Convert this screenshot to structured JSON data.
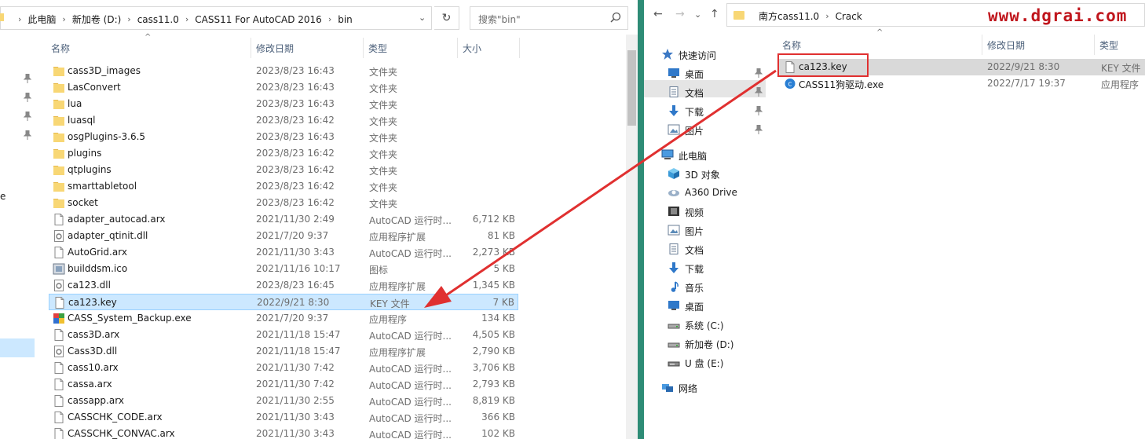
{
  "left_window": {
    "breadcrumb": [
      "此电脑",
      "新加卷 (D:)",
      "cass11.0",
      "CASS11 For AutoCAD 2016",
      "bin"
    ],
    "search_placeholder": "搜索\"bin\"",
    "columns": {
      "name": "名称",
      "date": "修改日期",
      "type": "类型",
      "size": "大小"
    },
    "cut_text": "e",
    "files": [
      {
        "name": "cass3D_images",
        "date": "2023/8/23 16:43",
        "type": "文件夹",
        "size": "",
        "icon": "folder-icon"
      },
      {
        "name": "LasConvert",
        "date": "2023/8/23 16:43",
        "type": "文件夹",
        "size": "",
        "icon": "folder-icon"
      },
      {
        "name": "lua",
        "date": "2023/8/23 16:43",
        "type": "文件夹",
        "size": "",
        "icon": "folder-icon"
      },
      {
        "name": "luasql",
        "date": "2023/8/23 16:42",
        "type": "文件夹",
        "size": "",
        "icon": "folder-icon"
      },
      {
        "name": "osgPlugins-3.6.5",
        "date": "2023/8/23 16:43",
        "type": "文件夹",
        "size": "",
        "icon": "folder-icon"
      },
      {
        "name": "plugins",
        "date": "2023/8/23 16:42",
        "type": "文件夹",
        "size": "",
        "icon": "folder-icon"
      },
      {
        "name": "qtplugins",
        "date": "2023/8/23 16:42",
        "type": "文件夹",
        "size": "",
        "icon": "folder-icon"
      },
      {
        "name": "smarttabletool",
        "date": "2023/8/23 16:42",
        "type": "文件夹",
        "size": "",
        "icon": "folder-icon"
      },
      {
        "name": "socket",
        "date": "2023/8/23 16:42",
        "type": "文件夹",
        "size": "",
        "icon": "folder-icon"
      },
      {
        "name": "adapter_autocad.arx",
        "date": "2021/11/30 2:49",
        "type": "AutoCAD 运行时...",
        "size": "6,712 KB",
        "icon": "document-icon"
      },
      {
        "name": "adapter_qtinit.dll",
        "date": "2021/7/20 9:37",
        "type": "应用程序扩展",
        "size": "81 KB",
        "icon": "dll-icon"
      },
      {
        "name": "AutoGrid.arx",
        "date": "2021/11/30 3:43",
        "type": "AutoCAD 运行时...",
        "size": "2,273 KB",
        "icon": "document-icon"
      },
      {
        "name": "builddsm.ico",
        "date": "2021/11/16 10:17",
        "type": "图标",
        "size": "5 KB",
        "icon": "ico-file-icon"
      },
      {
        "name": "ca123.dll",
        "date": "2023/8/23 16:45",
        "type": "应用程序扩展",
        "size": "1,345 KB",
        "icon": "dll-icon"
      },
      {
        "name": "ca123.key",
        "date": "2022/9/21 8:30",
        "type": "KEY 文件",
        "size": "7 KB",
        "icon": "document-icon",
        "selected": true
      },
      {
        "name": "CASS_System_Backup.exe",
        "date": "2021/7/20 9:37",
        "type": "应用程序",
        "size": "134 KB",
        "icon": "exe-icon"
      },
      {
        "name": "cass3D.arx",
        "date": "2021/11/18 15:47",
        "type": "AutoCAD 运行时...",
        "size": "4,505 KB",
        "icon": "document-icon"
      },
      {
        "name": "Cass3D.dll",
        "date": "2021/11/18 15:47",
        "type": "应用程序扩展",
        "size": "2,790 KB",
        "icon": "dll-icon"
      },
      {
        "name": "cass10.arx",
        "date": "2021/11/30 7:42",
        "type": "AutoCAD 运行时...",
        "size": "3,706 KB",
        "icon": "document-icon"
      },
      {
        "name": "cassa.arx",
        "date": "2021/11/30 7:42",
        "type": "AutoCAD 运行时...",
        "size": "2,793 KB",
        "icon": "document-icon"
      },
      {
        "name": "cassapp.arx",
        "date": "2021/11/30 2:55",
        "type": "AutoCAD 运行时...",
        "size": "8,819 KB",
        "icon": "document-icon"
      },
      {
        "name": "CASSCHK_CODE.arx",
        "date": "2021/11/30 3:43",
        "type": "AutoCAD 运行时...",
        "size": "366 KB",
        "icon": "document-icon"
      },
      {
        "name": "CASSCHK_CONVAC.arx",
        "date": "2021/11/30 3:43",
        "type": "AutoCAD 运行时...",
        "size": "102 KB",
        "icon": "document-icon"
      }
    ]
  },
  "right_window": {
    "breadcrumb": [
      "南方cass11.0",
      "Crack"
    ],
    "watermark": "www.dgrai.com",
    "columns": {
      "name": "名称",
      "date": "修改日期",
      "type": "类型"
    },
    "tree": [
      {
        "label": "快速访问",
        "icon": "star-icon",
        "level": 0,
        "pinned": false
      },
      {
        "label": "桌面",
        "icon": "desktop-icon",
        "level": 1,
        "pinned": true
      },
      {
        "label": "文档",
        "icon": "documents-icon",
        "level": 1,
        "pinned": true
      },
      {
        "label": "下载",
        "icon": "download-icon",
        "level": 1,
        "pinned": true
      },
      {
        "label": "图片",
        "icon": "pictures-icon",
        "level": 1,
        "pinned": true
      },
      {
        "label": "此电脑",
        "icon": "computer-icon",
        "level": 0,
        "pinned": false
      },
      {
        "label": "3D 对象",
        "icon": "3d-objects-icon",
        "level": 1,
        "pinned": false
      },
      {
        "label": "A360 Drive",
        "icon": "cloud-drive-icon",
        "level": 1,
        "pinned": false
      },
      {
        "label": "视频",
        "icon": "video-icon",
        "level": 1,
        "pinned": false
      },
      {
        "label": "图片",
        "icon": "pictures-icon",
        "level": 1,
        "pinned": false
      },
      {
        "label": "文档",
        "icon": "documents-icon",
        "level": 1,
        "pinned": false
      },
      {
        "label": "下载",
        "icon": "download-icon",
        "level": 1,
        "pinned": false
      },
      {
        "label": "音乐",
        "icon": "music-icon",
        "level": 1,
        "pinned": false
      },
      {
        "label": "桌面",
        "icon": "desktop-icon",
        "level": 1,
        "pinned": false
      },
      {
        "label": "系统 (C:)",
        "icon": "drive-icon",
        "level": 1,
        "pinned": false
      },
      {
        "label": "新加卷 (D:)",
        "icon": "drive-icon",
        "level": 1,
        "pinned": false
      },
      {
        "label": "U 盘 (E:)",
        "icon": "usb-drive-icon",
        "level": 1,
        "pinned": false
      },
      {
        "label": "网络",
        "icon": "network-icon",
        "level": 0,
        "pinned": false
      }
    ],
    "files": [
      {
        "name": "ca123.key",
        "date": "2022/9/21 8:30",
        "type": "KEY 文件",
        "icon": "document-icon",
        "selected": true
      },
      {
        "name": "CASS11狗驱动.exe",
        "date": "2022/7/17 19:37",
        "type": "应用程序",
        "icon": "exe-icon"
      }
    ]
  },
  "colors": {
    "accent": "#cce8ff",
    "annotation_red": "#e03030",
    "divider": "#2e8c76",
    "watermark": "#c0161d"
  }
}
